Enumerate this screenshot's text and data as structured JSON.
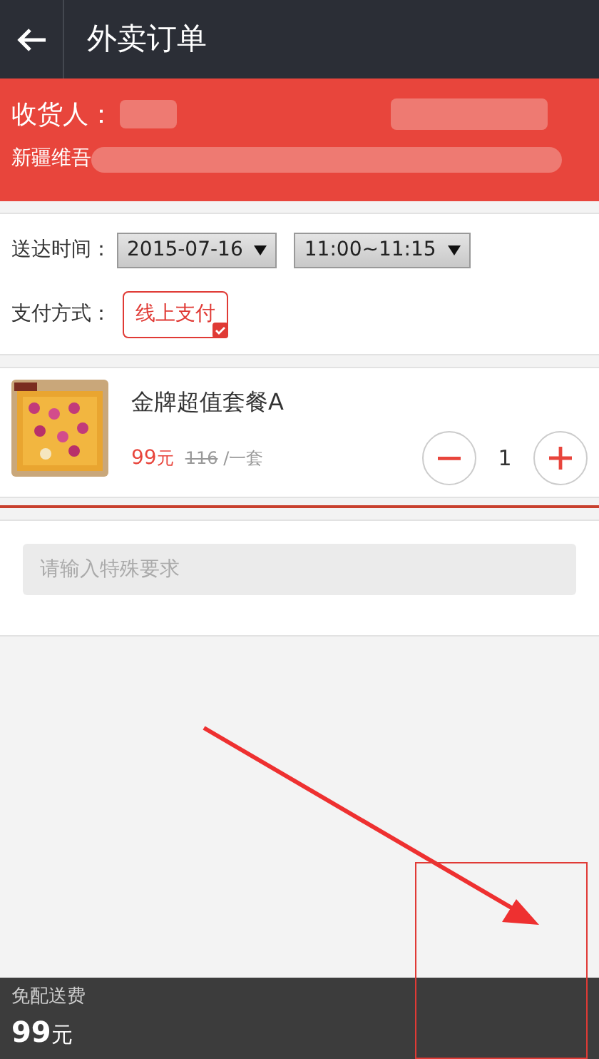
{
  "header": {
    "title": "外卖订单"
  },
  "receiver": {
    "label": "收货人：",
    "address": "新疆维吾"
  },
  "delivery": {
    "time_label": "送达时间：",
    "date": "2015-07-16",
    "time": "11:00~11:15",
    "payment_label": "支付方式：",
    "payment_options": [
      {
        "label": "线上支付",
        "selected": true
      }
    ]
  },
  "item": {
    "name": "金牌超值套餐A",
    "price": "99",
    "currency": "元",
    "original_price": "116",
    "unit": "/一套",
    "quantity": "1"
  },
  "note": {
    "placeholder": "请输入特殊要求"
  },
  "footer": {
    "delivery_fee": "免配送费",
    "total": "99",
    "currency": "元"
  }
}
